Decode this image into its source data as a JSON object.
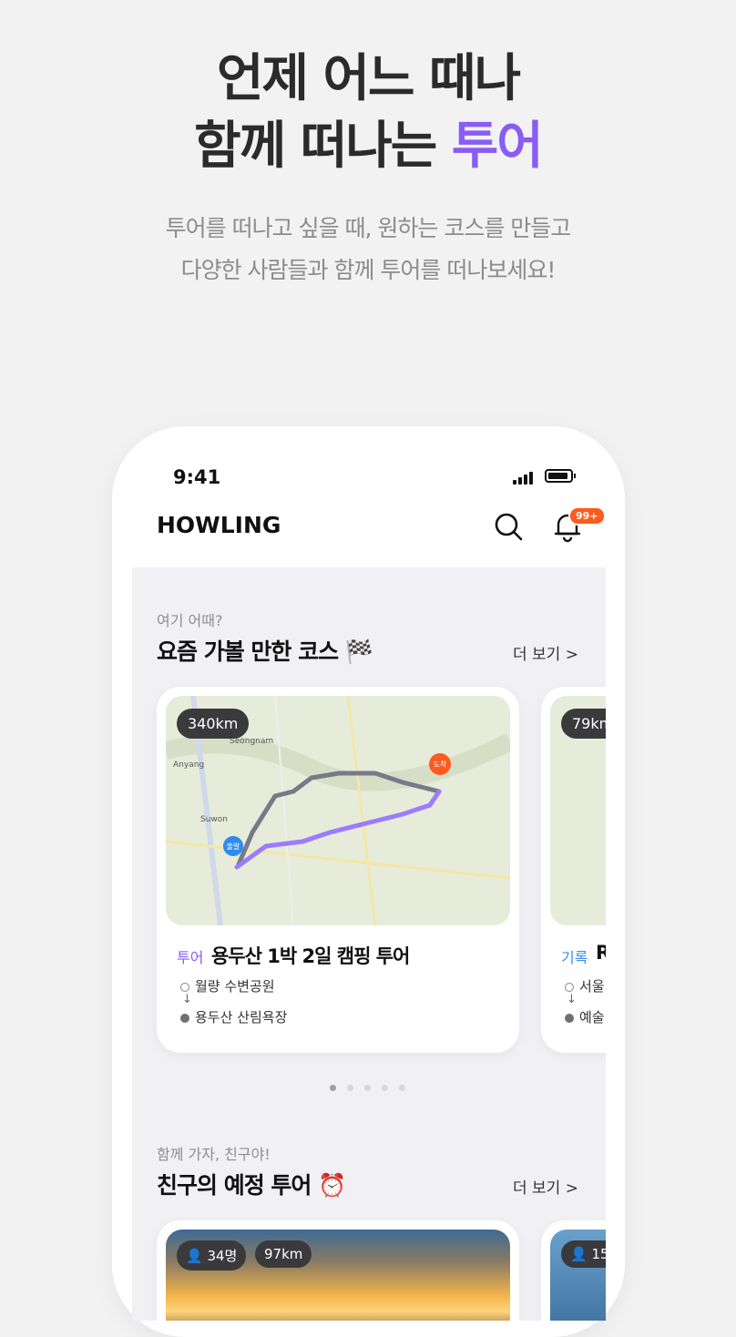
{
  "hero": {
    "line1": "언제 어느 때나",
    "line2_prefix": "함께 떠나는 ",
    "line2_accent": "투어",
    "desc_line1": "투어를 떠나고 싶을 때, 원하는 코스를 만들고",
    "desc_line2": "다양한 사람들과 함께 투어를 떠나보세요!",
    "accent_color": "#8a5cf6"
  },
  "status": {
    "time": "9:41"
  },
  "app": {
    "logo": "HOWLING",
    "notification_badge": "99+",
    "icons": [
      "search-icon",
      "bell-icon",
      "signal-icon",
      "battery-icon"
    ]
  },
  "section_courses": {
    "subtitle": "여기 어때?",
    "title": "요즘 가볼 만한 코스 🏁",
    "more": "더 보기 >",
    "cards": [
      {
        "distance": "340km",
        "tag": "투어",
        "tag_color": "#8a5cf6",
        "title": "용두산 1박 2일 캠핑 투어",
        "from": "월량 수변공원",
        "to": "용두산 산림욕장",
        "map_labels": {
          "start": "출발",
          "end": "도착"
        },
        "map_places": [
          "Seongnam",
          "Anyang",
          "Suwon"
        ]
      },
      {
        "distance": "79km",
        "tag": "기록",
        "tag_color": "#3b8ef5",
        "title": "R",
        "from": "서울",
        "to": "예술"
      }
    ],
    "pager": {
      "count": 5,
      "active": 0
    }
  },
  "section_friends": {
    "subtitle": "함께 가자, 친구야!",
    "title": "친구의 예정 투어 ⏰",
    "more": "더 보기 >",
    "cards": [
      {
        "people": "34명",
        "distance": "97km"
      },
      {
        "people": "15"
      }
    ]
  }
}
